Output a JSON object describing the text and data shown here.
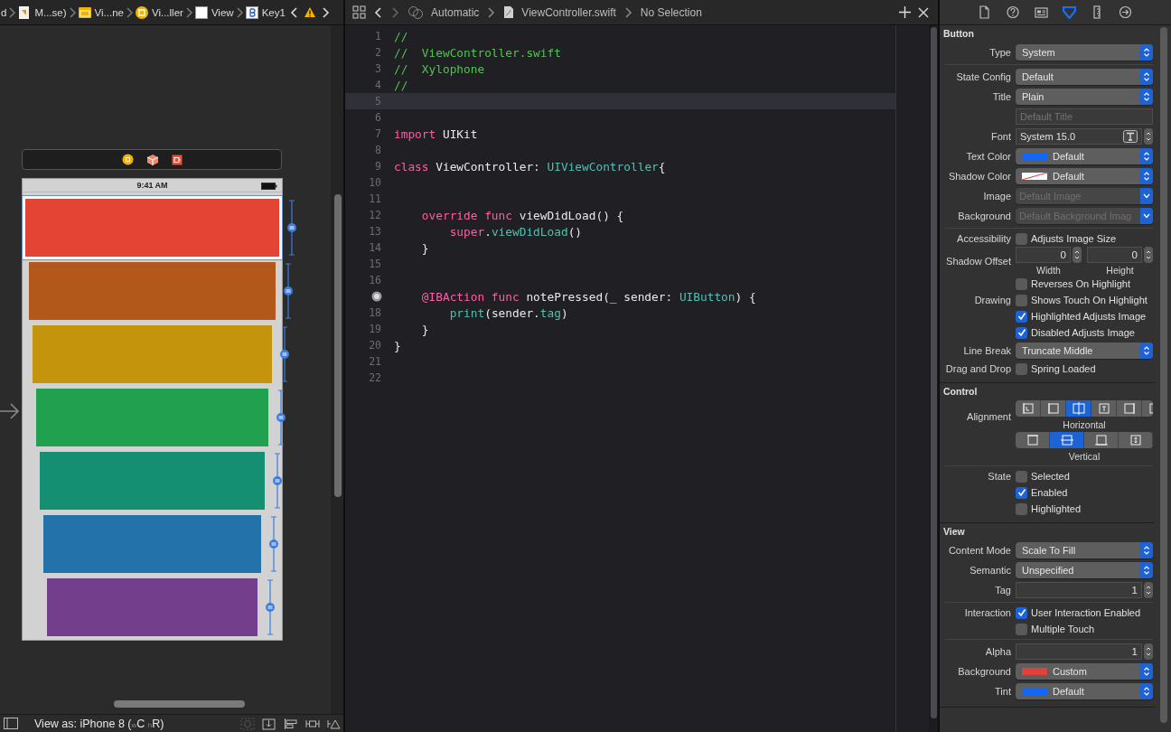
{
  "storyboard": {
    "breadcrumb": [
      {
        "kind": "plain",
        "label": "d"
      },
      {
        "kind": "storyboard",
        "label": "M...se)"
      },
      {
        "kind": "scene",
        "label": "Vi...ne"
      },
      {
        "kind": "controller",
        "label": "Vi...ller"
      },
      {
        "kind": "view",
        "label": "View"
      },
      {
        "kind": "button",
        "label": "Key1"
      }
    ],
    "status_time": "9:41 AM",
    "keys": [
      {
        "color": "#e44434",
        "selected": true
      },
      {
        "color": "#b2581a",
        "selected": false
      },
      {
        "color": "#c4950c",
        "selected": false
      },
      {
        "color": "#21a150",
        "selected": false
      },
      {
        "color": "#148f72",
        "selected": false
      },
      {
        "color": "#2472aa",
        "selected": false
      },
      {
        "color": "#733f8c",
        "selected": false
      }
    ],
    "view_as": "View as: iPhone 8 ($_{w}$C $_{h}$R)"
  },
  "editor": {
    "mode": "Automatic",
    "file": "ViewController.swift",
    "selection": "No Selection",
    "lines": [
      {
        "number": "1",
        "tokens": [
          {
            "kind": "comment",
            "t": "//"
          }
        ]
      },
      {
        "number": "2",
        "tokens": [
          {
            "kind": "comment",
            "t": "//  ViewController.swift"
          }
        ]
      },
      {
        "number": "3",
        "tokens": [
          {
            "kind": "comment",
            "t": "//  Xylophone"
          }
        ]
      },
      {
        "number": "4",
        "tokens": [
          {
            "kind": "comment",
            "t": "//"
          }
        ]
      },
      {
        "number": "5",
        "current": true
      },
      {
        "number": "6"
      },
      {
        "number": "7",
        "tokens": [
          {
            "kind": "keyword",
            "t": "import"
          },
          {
            "kind": "plain",
            "t": " UIKit"
          }
        ]
      },
      {
        "number": "8"
      },
      {
        "number": "9",
        "tokens": [
          {
            "kind": "keyword",
            "t": "class"
          },
          {
            "kind": "plain",
            "t": " ViewController: "
          },
          {
            "kind": "type",
            "t": "UIViewController"
          },
          {
            "kind": "plain",
            "t": "{"
          }
        ]
      },
      {
        "number": "10"
      },
      {
        "number": "11"
      },
      {
        "number": "12",
        "tokens": [
          {
            "kind": "keyword",
            "t": "    override func"
          },
          {
            "kind": "plain",
            "t": " viewDidLoad() {"
          }
        ]
      },
      {
        "number": "13",
        "tokens": [
          {
            "kind": "keyword",
            "t": "        super"
          },
          {
            "kind": "plain",
            "t": "."
          },
          {
            "kind": "type",
            "t": "viewDidLoad"
          },
          {
            "kind": "plain",
            "t": "()"
          }
        ]
      },
      {
        "number": "14",
        "tokens": [
          {
            "kind": "plain",
            "t": "    }"
          }
        ]
      },
      {
        "number": "15"
      },
      {
        "number": "16"
      },
      {
        "connected": true,
        "tokens": [
          {
            "kind": "keyword",
            "t": "    @IBAction func"
          },
          {
            "kind": "plain",
            "t": " notePressed(_ sender: "
          },
          {
            "kind": "type",
            "t": "UIButton"
          },
          {
            "kind": "plain",
            "t": ") {"
          }
        ]
      },
      {
        "number": "18",
        "tokens": [
          {
            "kind": "type",
            "t": "        print"
          },
          {
            "kind": "plain",
            "t": "(sender."
          },
          {
            "kind": "type",
            "t": "tag"
          },
          {
            "kind": "plain",
            "t": ")"
          }
        ]
      },
      {
        "number": "19",
        "tokens": [
          {
            "kind": "plain",
            "t": "    }"
          }
        ]
      },
      {
        "number": "20",
        "tokens": [
          {
            "kind": "plain",
            "t": "}"
          }
        ]
      },
      {
        "number": "21"
      },
      {
        "number": "22"
      }
    ]
  },
  "inspector": {
    "tabs": [
      {
        "kind": "file",
        "selected": false
      },
      {
        "kind": "help",
        "selected": false
      },
      {
        "kind": "identity",
        "selected": false
      },
      {
        "kind": "attributes",
        "selected": true
      },
      {
        "kind": "size",
        "selected": false
      },
      {
        "kind": "connections",
        "selected": false
      }
    ],
    "sections": [
      {
        "title": "Button",
        "groups": [
          [
            {
              "kind": "popup",
              "label": "Type",
              "value": "System"
            }
          ],
          [
            {
              "kind": "popup",
              "label": "State Config",
              "value": "Default"
            },
            {
              "kind": "popup",
              "label": "Title",
              "value": "Plain"
            },
            {
              "kind": "text_field",
              "placeholder": "Default Title"
            },
            {
              "kind": "font_field",
              "label": "Font",
              "value": "System 15.0"
            },
            {
              "kind": "color_popup",
              "label": "Text Color",
              "color": "#1467f5",
              "value": "Default"
            },
            {
              "kind": "clear_color_popup",
              "label": "Shadow Color",
              "value": "Default"
            },
            {
              "kind": "image_popup",
              "label": "Image",
              "placeholder": "Default Image"
            },
            {
              "kind": "image_popup",
              "label": "Background",
              "placeholder": "Default Background Imag"
            }
          ],
          [
            {
              "kind": "checkbox",
              "label": "Accessibility",
              "text": "Adjusts Image Size",
              "checked": false
            },
            {
              "kind": "offset",
              "label": "Shadow Offset",
              "fields": [
                {
                  "value": "0",
                  "caption": "Width"
                },
                {
                  "value": "0",
                  "caption": "Height"
                }
              ]
            },
            {
              "kind": "checkbox",
              "text": "Reverses On Highlight",
              "checked": false
            },
            {
              "kind": "checkbox",
              "label": "Drawing",
              "text": "Shows Touch On Highlight",
              "checked": false
            },
            {
              "kind": "checkbox",
              "text": "Highlighted Adjusts Image",
              "checked": true
            },
            {
              "kind": "checkbox",
              "text": "Disabled Adjusts Image",
              "checked": true
            },
            {
              "kind": "popup",
              "label": "Line Break",
              "value": "Truncate Middle"
            },
            {
              "kind": "checkbox",
              "label": "Drag and Drop",
              "text": "Spring Loaded",
              "checked": false
            }
          ]
        ]
      },
      {
        "title": "Control",
        "groups": [
          [
            {
              "kind": "segments",
              "label": "Alignment",
              "caption": "Horizontal",
              "items": [
                {
                  "kind": "left",
                  "selected": false
                },
                {
                  "kind": "leading",
                  "selected": false
                },
                {
                  "kind": "center",
                  "selected": true
                },
                {
                  "kind": "text",
                  "selected": false
                },
                {
                  "kind": "right",
                  "selected": false
                },
                {
                  "kind": "trailing",
                  "selected": false
                }
              ]
            },
            {
              "kind": "segments",
              "caption": "Vertical",
              "items": [
                {
                  "kind": "top",
                  "selected": false
                },
                {
                  "kind": "middle",
                  "selected": true
                },
                {
                  "kind": "bottom",
                  "selected": false
                },
                {
                  "kind": "fill",
                  "selected": false
                }
              ]
            }
          ],
          [
            {
              "kind": "checkbox",
              "label": "State",
              "text": "Selected",
              "checked": false
            },
            {
              "kind": "checkbox",
              "text": "Enabled",
              "checked": true
            },
            {
              "kind": "checkbox",
              "text": "Highlighted",
              "checked": false
            }
          ]
        ]
      },
      {
        "title": "View",
        "groups": [
          [
            {
              "kind": "popup",
              "label": "Content Mode",
              "value": "Scale To Fill"
            },
            {
              "kind": "popup",
              "label": "Semantic",
              "value": "Unspecified"
            },
            {
              "kind": "stepper_field",
              "label": "Tag",
              "value": "1"
            }
          ],
          [
            {
              "kind": "checkbox",
              "label": "Interaction",
              "text": "User Interaction Enabled",
              "checked": true
            },
            {
              "kind": "checkbox",
              "text": "Multiple Touch",
              "checked": false
            }
          ],
          [
            {
              "kind": "stepper_field",
              "label": "Alpha",
              "value": "1"
            },
            {
              "kind": "color_popup",
              "label": "Background",
              "color": "#e0413a",
              "value": "Custom"
            },
            {
              "kind": "color_popup",
              "label": "Tint",
              "color": "#1467f5",
              "value": "Default"
            }
          ]
        ]
      }
    ]
  }
}
